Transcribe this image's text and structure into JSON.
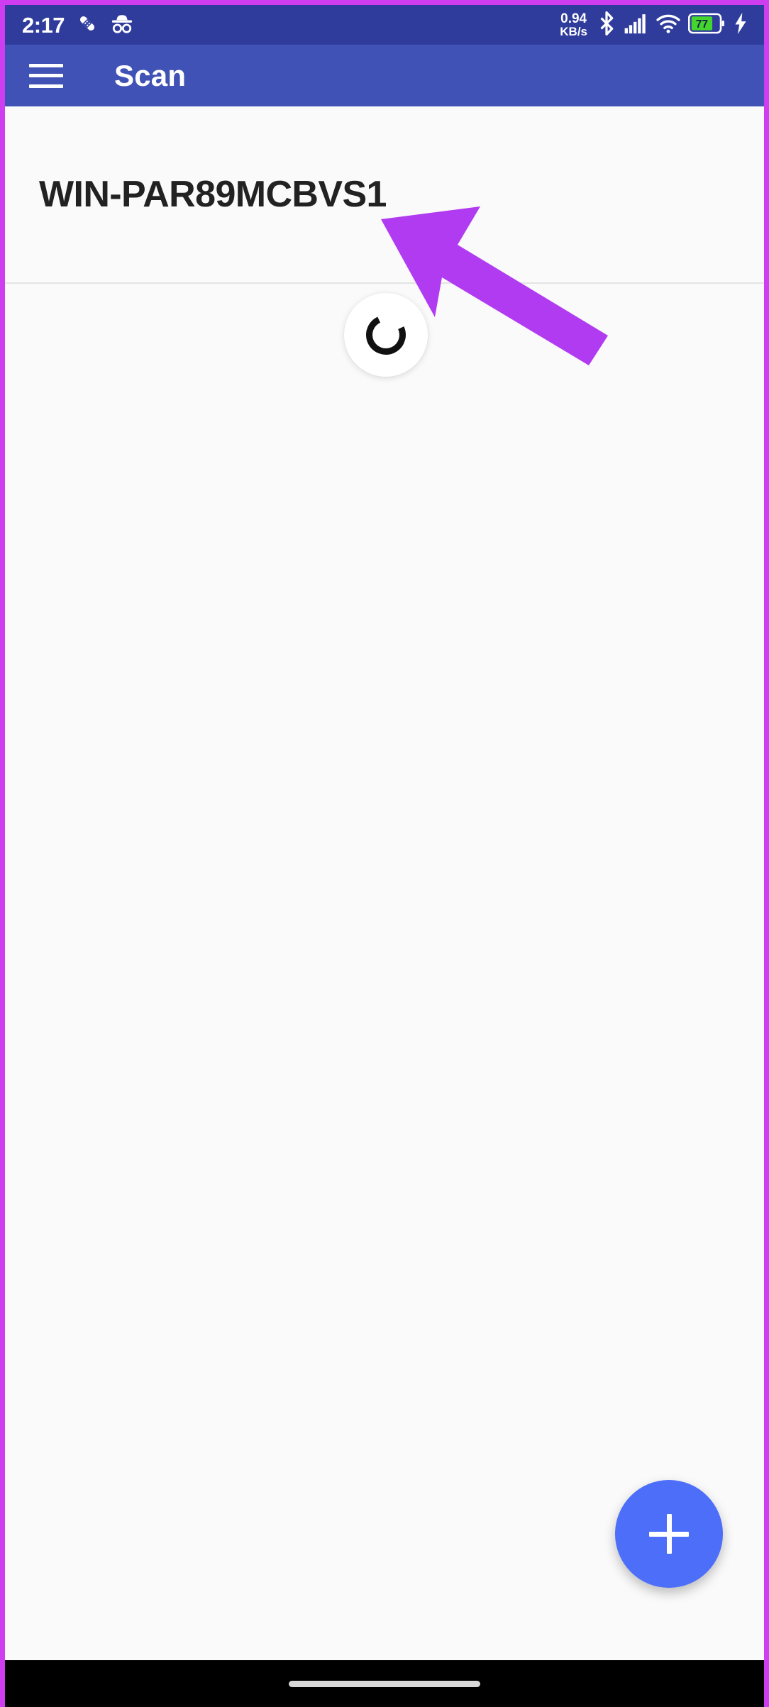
{
  "theme": {
    "status_bar_color": "#2F3C9C",
    "app_bar_color": "#4052B5",
    "background_color": "#FAFAFA",
    "fab_color": "#4C6EF9",
    "annotation_arrow_color": "#B13BF0",
    "capture_border_color": "#CF3DF0",
    "battery_fill_color": "#44D62C",
    "text_primary_color": "#222222"
  },
  "status_bar": {
    "time": "2:17",
    "left_icons": [
      {
        "name": "bandage-icon",
        "label": "bandage"
      },
      {
        "name": "incognito-icon",
        "label": "incognito"
      }
    ],
    "network_speed": {
      "value": "0.94",
      "unit": "KB/s"
    },
    "right_icons": [
      {
        "name": "bluetooth-icon",
        "label": "bluetooth"
      },
      {
        "name": "cellular-signal-icon",
        "label": "signal",
        "bars": 5
      },
      {
        "name": "wifi-icon",
        "label": "wifi"
      },
      {
        "name": "battery-icon",
        "label": "battery"
      },
      {
        "name": "charging-bolt-icon",
        "label": "charging"
      }
    ],
    "battery_percent": "77"
  },
  "app_bar": {
    "menu_icon": "hamburger-menu-icon",
    "title": "Scan"
  },
  "content": {
    "host": {
      "name": "WIN-PAR89MCBVS1"
    },
    "scan_status": {
      "state": "loading",
      "icon": "loading-spinner-icon"
    }
  },
  "fab": {
    "icon": "plus-icon",
    "label": "+"
  },
  "nav_bar": {
    "gesture_pill": "home-gesture-pill"
  },
  "annotation": {
    "arrow": "pointer-arrow-annotation",
    "points_at": "WIN-PAR89MCBVS1"
  }
}
